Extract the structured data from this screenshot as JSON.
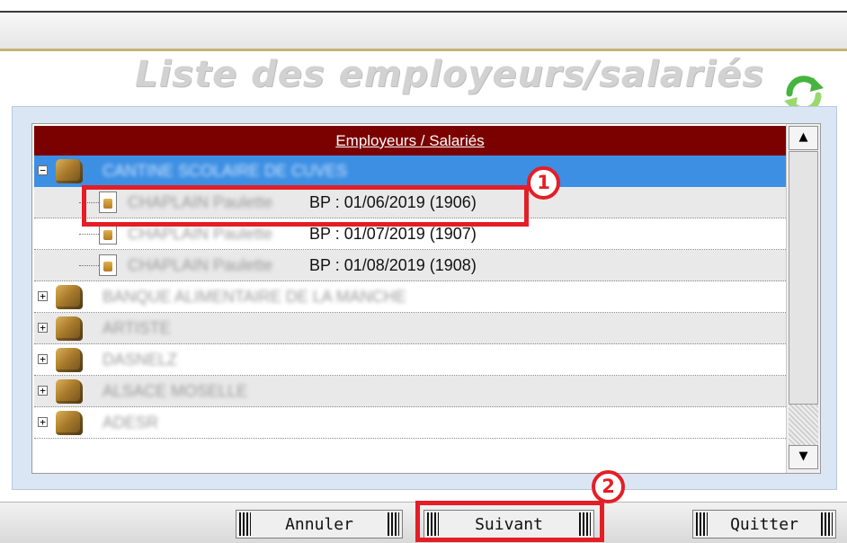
{
  "window": {
    "title": "Liste des employeurs/salariés"
  },
  "list": {
    "header": "Employeurs / Salariés",
    "employers": [
      {
        "name": "CANTINE SCOLAIRE DE CUVES",
        "expanded": true,
        "selected": true,
        "employees": [
          {
            "name": "CHAPLAIN Paulette",
            "bp": "BP : 01/06/2019 (1906)"
          },
          {
            "name": "CHAPLAIN Paulette",
            "bp": "BP : 01/07/2019 (1907)"
          },
          {
            "name": "CHAPLAIN Paulette",
            "bp": "BP : 01/08/2019 (1908)"
          }
        ]
      },
      {
        "name": "BANQUE ALIMENTAIRE DE LA MANCHE",
        "expanded": false
      },
      {
        "name": "ARTISTE",
        "expanded": false
      },
      {
        "name": "DASNELZ",
        "expanded": false
      },
      {
        "name": "ALSACE MOSELLE",
        "expanded": false
      },
      {
        "name": "ADESR",
        "expanded": false
      }
    ],
    "expand_glyph": "+",
    "collapse_glyph": "−"
  },
  "scroll": {
    "up_glyph": "▲",
    "down_glyph": "▼"
  },
  "buttons": {
    "cancel": "Annuler",
    "next": "Suivant",
    "quit": "Quitter"
  },
  "annotations": {
    "step1": "1",
    "step2": "2"
  },
  "colors": {
    "header_bg": "#7b0000",
    "selected_bg": "#3c8fe3",
    "annotation_red": "#e41e26",
    "frame_bg": "#dbe6f4"
  },
  "icons": {
    "refresh": "refresh-arrows-icon",
    "employer": "folder-box-icon",
    "employee": "payslip-document-icon"
  }
}
